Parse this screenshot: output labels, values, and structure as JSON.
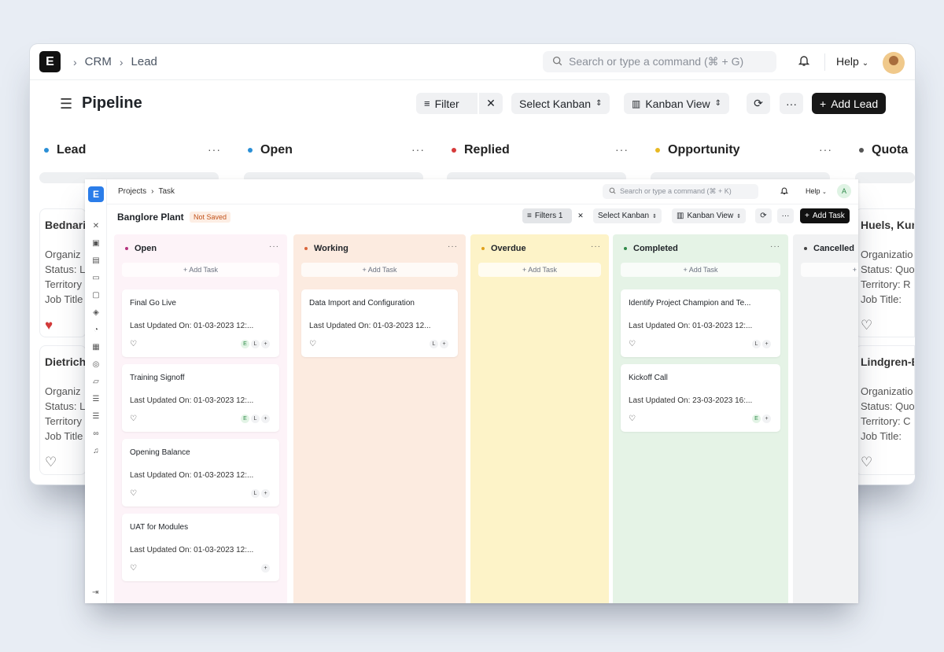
{
  "crm": {
    "breadcrumb": [
      "CRM",
      "Lead"
    ],
    "search_placeholder": "Search or type a command (⌘ + G)",
    "help_label": "Help",
    "page_title": "Pipeline",
    "filter_label": "Filter",
    "select_kanban_label": "Select Kanban",
    "kanban_view_label": "Kanban View",
    "add_lead_label": "Add Lead",
    "columns": [
      {
        "label": "Lead",
        "color": "#2b8fd6"
      },
      {
        "label": "Open",
        "color": "#2b8fd6"
      },
      {
        "label": "Replied",
        "color": "#d63b3b"
      },
      {
        "label": "Opportunity",
        "color": "#e8b923"
      },
      {
        "label": "Quota",
        "color": "#555555"
      }
    ],
    "left_cards": [
      {
        "name": "Bednari",
        "org": "Organiz",
        "status": "Status: L",
        "territory": "Territory",
        "job": "Job Title",
        "liked": true
      },
      {
        "name": "Dietrich",
        "org": "Organiz",
        "status": "Status: L",
        "territory": "Territory",
        "job": "Job Title",
        "liked": false
      }
    ],
    "right_cards": [
      {
        "name": "Huels, Kun",
        "org": "Organizatio",
        "status": "Status: Quo",
        "territory": "Territory: R",
        "job": "Job Title:"
      },
      {
        "name": "Lindgren-B",
        "org": "Organizatio",
        "status": "Status: Quo",
        "territory": "Territory: C",
        "job": "Job Title:"
      }
    ]
  },
  "projects": {
    "breadcrumb": [
      "Projects",
      "Task"
    ],
    "search_placeholder": "Search or type a command (⌘ + K)",
    "help_label": "Help",
    "avatar_initial": "A",
    "page_title": "Banglore Plant",
    "status_badge": "Not Saved",
    "filters_label": "Filters 1",
    "select_kanban_label": "Select Kanban",
    "kanban_view_label": "Kanban View",
    "add_task_label": "Add Task",
    "add_task_inline": "+ Add Task",
    "columns": [
      {
        "label": "Open",
        "color": "#b5327e",
        "bg": "#fdf3f8",
        "cards": [
          {
            "title": "Final Go Live",
            "updated": "Last Updated On: 01-03-2023 12:...",
            "assignees": [
              "E",
              "L",
              "+"
            ]
          },
          {
            "title": "Training Signoff",
            "updated": "Last Updated On: 01-03-2023 12:...",
            "assignees": [
              "E",
              "L",
              "+"
            ]
          },
          {
            "title": "Opening Balance",
            "updated": "Last Updated On: 01-03-2023 12:...",
            "assignees": [
              "L",
              "+"
            ]
          },
          {
            "title": "UAT for Modules",
            "updated": "Last Updated On: 01-03-2023 12:...",
            "assignees": [
              "+"
            ]
          }
        ]
      },
      {
        "label": "Working",
        "color": "#d9653b",
        "bg": "#fcebe0",
        "cards": [
          {
            "title": "Data Import and Configuration",
            "updated": "Last Updated On: 01-03-2023 12...",
            "assignees": [
              "L",
              "+"
            ]
          }
        ]
      },
      {
        "label": "Overdue",
        "color": "#e0a11b",
        "bg": "#fdf3c8",
        "cards": []
      },
      {
        "label": "Completed",
        "color": "#2f8a49",
        "bg": "#e5f3e6",
        "cards": [
          {
            "title": "Identify Project Champion and Te...",
            "updated": "Last Updated On: 01-03-2023 12:...",
            "assignees": [
              "L",
              "+"
            ]
          },
          {
            "title": "Kickoff Call",
            "updated": "Last Updated On: 23-03-2023 16:...",
            "assignees": [
              "E",
              "+"
            ]
          }
        ]
      },
      {
        "label": "Cancelled",
        "color": "#444444",
        "bg": "#f1f2f3",
        "cards": []
      }
    ]
  }
}
